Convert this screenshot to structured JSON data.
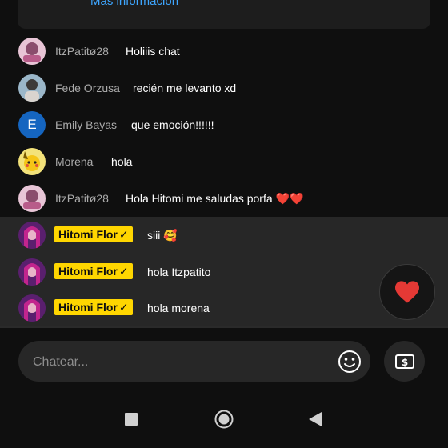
{
  "top_card": {
    "link_text": "Más información"
  },
  "chat": {
    "messages": [
      {
        "author": "ItzPatitø28",
        "text": "Holiiis chat",
        "avatar": "patito-avatar"
      },
      {
        "author": "Fede Orzusa",
        "text": "recién me levanto xd",
        "avatar": "fede-avatar"
      },
      {
        "author": "Emily Bayas",
        "text": "que emoción!!!!!!",
        "avatar": "letter-avatar",
        "avatar_letter": "E",
        "avatar_color": "#1565c0"
      },
      {
        "author": "Morena",
        "text": "hola",
        "avatar": "pikachu-avatar"
      },
      {
        "author": "ItzPatitø28",
        "text": "Hola Hitomi me saludas porfa ❤️❤️",
        "avatar": "patito-avatar"
      },
      {
        "author": "Hitomi Flor",
        "text": "siii 🥰",
        "avatar": "hitomi-avatar",
        "owner": true
      },
      {
        "author": "Hitomi Flor",
        "text": "hola Itzpatito",
        "avatar": "hitomi-avatar",
        "owner": true
      },
      {
        "author": "Hitomi Flor",
        "text": "hola morena",
        "avatar": "hitomi-avatar",
        "owner": true
      }
    ],
    "owner_badge_check": "✓"
  },
  "input": {
    "placeholder": "Chatear..."
  },
  "colors": {
    "owner_badge": "#ffd600",
    "highlight_bg": "#272727",
    "link": "#3ea6ff",
    "heart": "#e53935"
  },
  "icons": {
    "heart": "heart-icon",
    "emoji": "smiley-icon",
    "superchat": "dollar-bill-icon",
    "nav_recent": "square-icon",
    "nav_home": "circle-icon",
    "nav_back": "triangle-back-icon"
  }
}
